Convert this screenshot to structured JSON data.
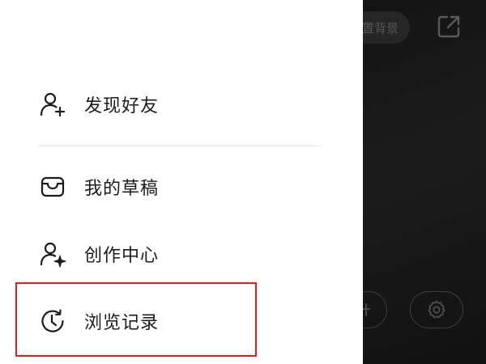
{
  "drawer": {
    "items": [
      {
        "label": "发现好友",
        "icon": "add-friend-icon"
      },
      {
        "label": "我的草稿",
        "icon": "inbox-tray-icon"
      },
      {
        "label": "创作中心",
        "icon": "creator-sparkle-icon"
      },
      {
        "label": "浏览记录",
        "icon": "history-clock-icon"
      }
    ],
    "highlighted_item": "浏览记录",
    "highlight_color": "#e01e1e"
  },
  "backdrop": {
    "background_button_label": "置背景",
    "share_icon": "share-external-icon",
    "settings_icon": "gear-icon",
    "color": "#161616"
  }
}
